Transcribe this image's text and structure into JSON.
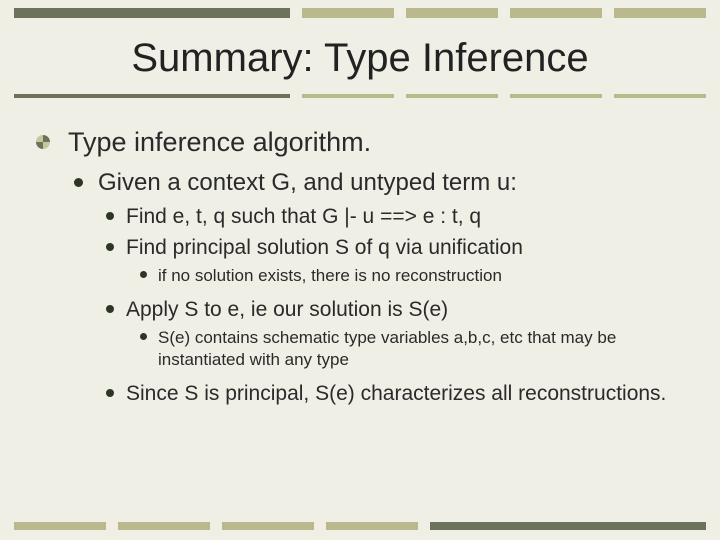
{
  "title": "Summary: Type Inference",
  "bullets": {
    "l1": "Type inference algorithm.",
    "l2_1": "Given a context G, and untyped term u:",
    "l3_1": "Find e, t, q such that G |- u ==> e : t, q",
    "l3_2": "Find principal solution S of q via unification",
    "l4_1": "if no solution exists, there is no reconstruction",
    "l3_3": "Apply S to e, ie our solution is S(e)",
    "l4_2": "S(e) contains schematic type variables a,b,c, etc that may be instantiated with any type",
    "l3_4": "Since S is principal, S(e) characterizes all reconstructions."
  }
}
